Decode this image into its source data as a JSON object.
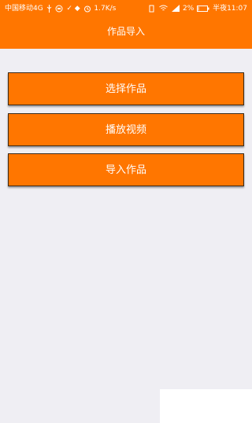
{
  "status_bar": {
    "carrier": "中国移动4G",
    "speed": "1.7K/s",
    "battery": "2%",
    "time": "半夜11:07"
  },
  "header": {
    "title": "作品导入"
  },
  "actions": {
    "select_label": "选择作品",
    "play_label": "播放视频",
    "import_label": "导入作品"
  },
  "colors": {
    "accent": "#ff7600",
    "background": "#efeef3"
  },
  "icons": [
    "usb-icon",
    "sync-icon",
    "alarm-icon",
    "signal-icon",
    "wifi-icon",
    "battery-icon"
  ]
}
